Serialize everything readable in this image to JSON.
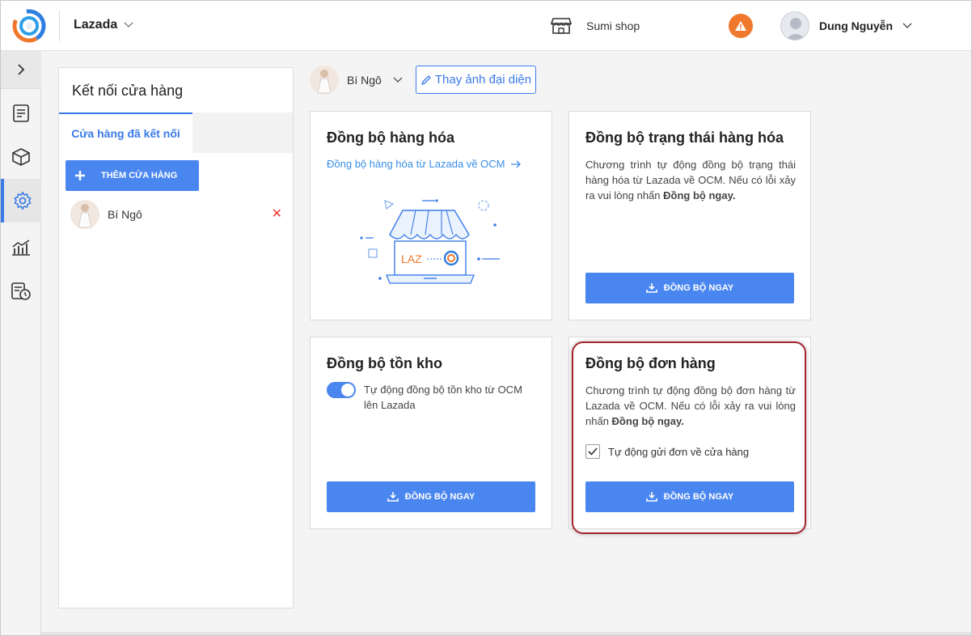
{
  "header": {
    "platform": "Lazada",
    "shop_name": "Sumi shop",
    "user_name": "Dung Nguyễn"
  },
  "store_panel": {
    "title": "Kết nối cửa hàng",
    "tab_connected": "Cửa hàng đã kết nối",
    "add_button": "THÊM CỬA HÀNG",
    "stores": [
      {
        "name": "Bí Ngô"
      }
    ]
  },
  "main": {
    "account_name": "Bí Ngô",
    "change_avatar": "Thay ảnh đại diện",
    "cards": {
      "products": {
        "title": "Đồng bộ hàng hóa",
        "link": "Đồng bộ hàng hóa từ Lazada về OCM",
        "illustration_text": "LAZ"
      },
      "product_status": {
        "title": "Đồng bộ trạng thái hàng hóa",
        "desc": "Chương trình tự động đồng bộ trạng thái hàng hóa từ Lazada về OCM. Nếu có lỗi xảy ra vui lòng nhấn",
        "desc_bold": "Đồng bộ ngay.",
        "button": "ĐỒNG BỘ NGAY"
      },
      "inventory": {
        "title": "Đồng bộ tồn kho",
        "toggle_label": "Tự động đồng bộ tồn kho từ OCM lên Lazada",
        "toggle_on": true,
        "button": "ĐỒNG BỘ NGAY"
      },
      "orders": {
        "title": "Đồng bộ đơn hàng",
        "desc": "Chương trình tự động đồng bộ đơn hàng từ Lazada về OCM. Nếu có lỗi xảy ra vui lòng nhấn",
        "desc_bold": "Đồng bộ ngay.",
        "checkbox_label": "Tự động gửi đơn về cửa hàng",
        "checkbox_checked": true,
        "button": "ĐỒNG BỘ NGAY"
      }
    }
  },
  "colors": {
    "accent": "#4a86ef",
    "warning": "#f0782d",
    "highlight": "#a5242c"
  }
}
